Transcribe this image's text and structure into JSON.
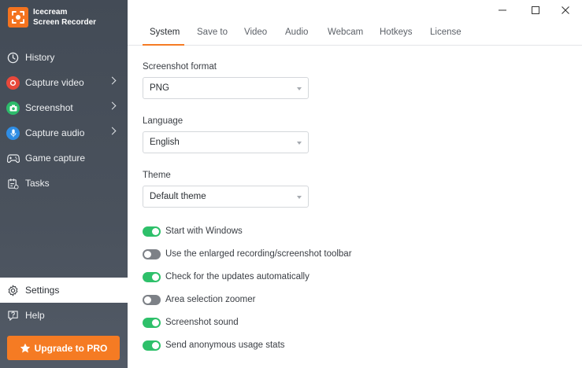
{
  "app": {
    "name_line1": "Icecream",
    "name_line2": "Screen Recorder",
    "brand_color": "#f4731f"
  },
  "sidebar": {
    "items": [
      {
        "label": "History",
        "icon": "clock-icon"
      },
      {
        "label": "Capture video",
        "icon": "record-icon"
      },
      {
        "label": "Screenshot",
        "icon": "camera-icon"
      },
      {
        "label": "Capture audio",
        "icon": "microphone-icon"
      },
      {
        "label": "Game capture",
        "icon": "gamepad-icon"
      },
      {
        "label": "Tasks",
        "icon": "tasks-icon"
      }
    ],
    "bottom": [
      {
        "label": "Settings",
        "icon": "gear-icon",
        "active": true
      },
      {
        "label": "Help",
        "icon": "help-icon"
      }
    ],
    "upgrade_label": "Upgrade to PRO"
  },
  "tabs": [
    "System",
    "Save to",
    "Video",
    "Audio",
    "Webcam",
    "Hotkeys",
    "License"
  ],
  "active_tab": "System",
  "settings": {
    "screenshot_format": {
      "label": "Screenshot format",
      "value": "PNG"
    },
    "language": {
      "label": "Language",
      "value": "English"
    },
    "theme": {
      "label": "Theme",
      "value": "Default theme"
    },
    "toggles": [
      {
        "label": "Start with Windows",
        "on": true
      },
      {
        "label": "Use the enlarged recording/screenshot toolbar",
        "on": false
      },
      {
        "label": "Check for the updates automatically",
        "on": true
      },
      {
        "label": "Area selection zoomer",
        "on": false
      },
      {
        "label": "Screenshot sound",
        "on": true
      },
      {
        "label": "Send anonymous usage stats",
        "on": true
      }
    ]
  },
  "colors": {
    "accent": "#f57b23",
    "toggle_on": "#2ec06a",
    "toggle_off": "#7d8187",
    "sidebar": "#474f5a"
  }
}
